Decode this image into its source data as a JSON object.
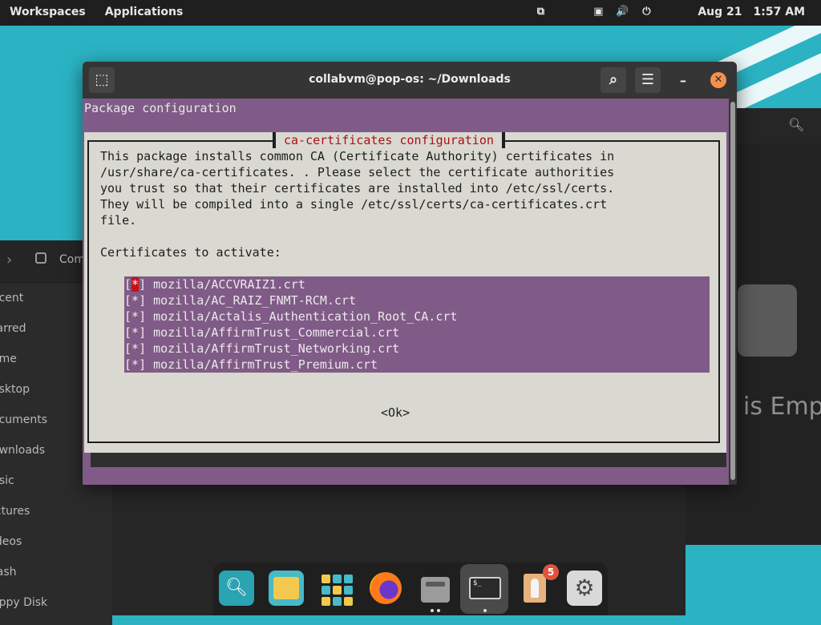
{
  "topbar": {
    "workspaces": "Workspaces",
    "applications": "Applications",
    "date": "Aug 21",
    "time": "1:57 AM",
    "icons": [
      "screen-icon",
      "tray-icon",
      "volume-icon",
      "power-icon"
    ]
  },
  "file_manager": {
    "breadcrumb": "Comp",
    "sidebar": [
      "ecent",
      "tarred",
      "ome",
      "esktop",
      "ocuments",
      "ownloads",
      "usic",
      "ictures",
      "ideos",
      "rash",
      "oppy Disk"
    ],
    "empty_text": "is Empt"
  },
  "terminal": {
    "title": "collabvm@pop-os: ~/Downloads",
    "package_title": "Package configuration",
    "dialog_title": "ca-certificates configuration",
    "body_lines": [
      "This package installs common CA (Certificate Authority) certificates in",
      "/usr/share/ca-certificates. . Please select the certificate authorities",
      "you trust so that their certificates are installed into /etc/ssl/certs.",
      "They will be compiled into a single /etc/ssl/certs/ca-certificates.crt",
      "file.",
      "",
      "Certificates to activate:"
    ],
    "certificates": [
      {
        "mark": "*",
        "name": "mozilla/ACCVRAIZ1.crt"
      },
      {
        "mark": "*",
        "name": "mozilla/AC_RAIZ_FNMT-RCM.crt"
      },
      {
        "mark": "*",
        "name": "mozilla/Actalis_Authentication_Root_CA.crt"
      },
      {
        "mark": "*",
        "name": "mozilla/AffirmTrust_Commercial.crt"
      },
      {
        "mark": "*",
        "name": "mozilla/AffirmTrust_Networking.crt"
      },
      {
        "mark": "*",
        "name": "mozilla/AffirmTrust_Premium.crt"
      }
    ],
    "ok_label": "<Ok>"
  },
  "dock": {
    "items": [
      "search-app-icon",
      "files-app-icon",
      "app-grid-icon",
      "firefox-icon",
      "file-manager-icon",
      "terminal-icon",
      "installer-icon",
      "settings-icon"
    ],
    "installer_badge": "5"
  },
  "colors": {
    "terminal_bg": "#805b87",
    "dialog_bg": "#d9d9d1",
    "dialog_title": "#aa1118",
    "desktop": "#2bb3c3"
  }
}
